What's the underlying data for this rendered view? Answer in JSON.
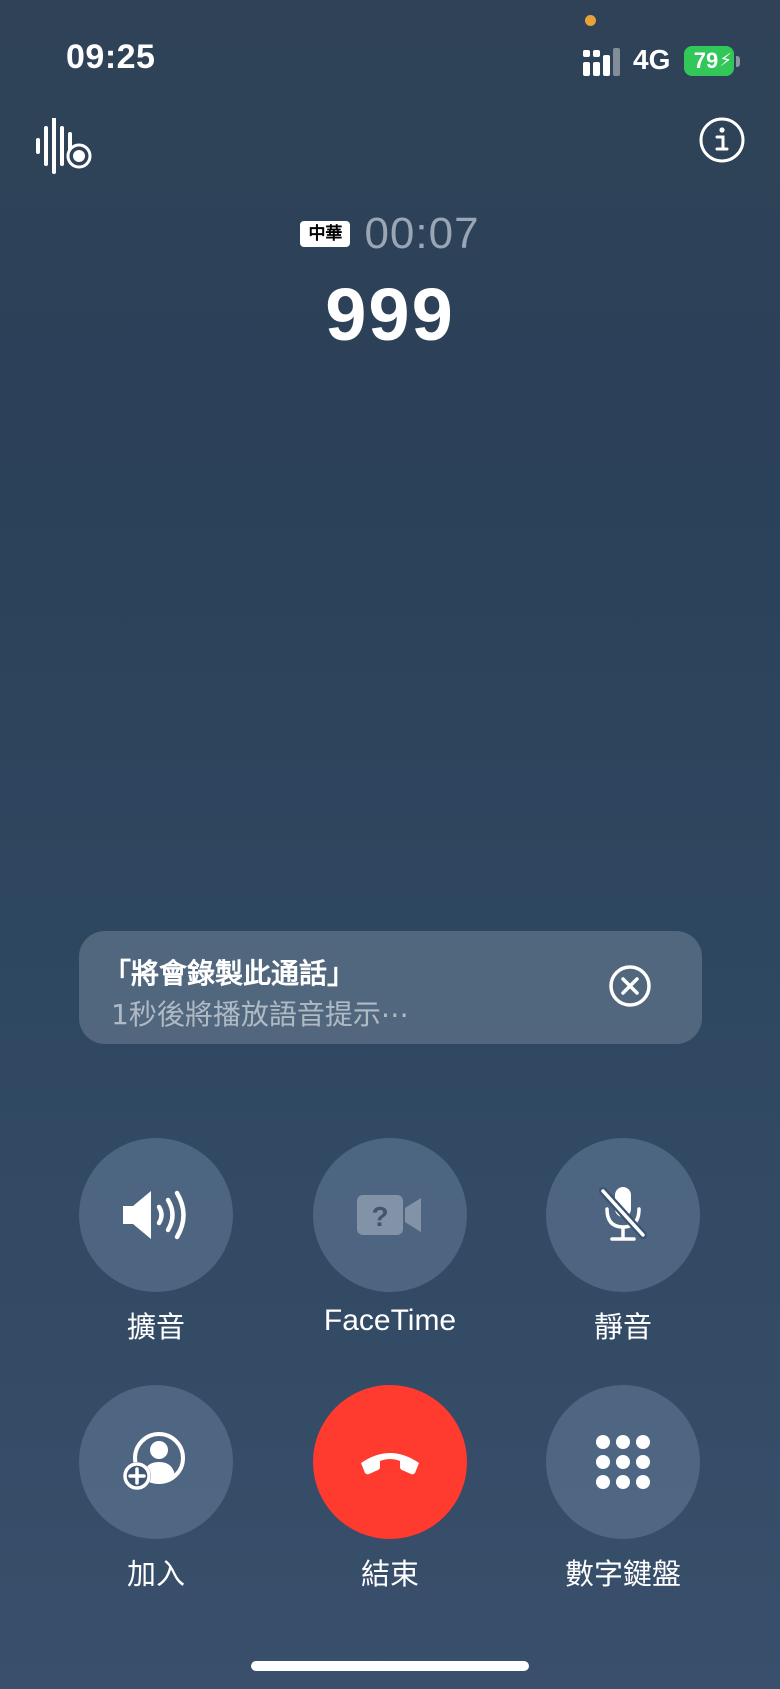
{
  "status_bar": {
    "time": "09:25",
    "network": "4G",
    "battery": "79",
    "signal_bars": 4,
    "privacy_dot_color": "#e9a237",
    "battery_color": "#32c759"
  },
  "top_icons": {
    "left": "voice-waveform-record-icon",
    "right": "info-icon"
  },
  "call": {
    "carrier": "中華",
    "duration": "00:07",
    "number": "999"
  },
  "notice": {
    "title": "「將會錄製此通話」",
    "subtitle": "1秒後將播放語音提示⋯",
    "close_icon": "close-circle-icon"
  },
  "controls": [
    {
      "label": "擴音",
      "icon": "speaker-icon"
    },
    {
      "label": "FaceTime",
      "icon": "facetime-unavailable-icon"
    },
    {
      "label": "靜音",
      "icon": "mute-microphone-icon"
    },
    {
      "label": "加入",
      "icon": "add-call-icon"
    },
    {
      "label": "結束",
      "icon": "end-call-icon"
    },
    {
      "label": "數字鍵盤",
      "icon": "keypad-icon"
    }
  ],
  "colors": {
    "end_call": "#ff3b30",
    "button_bg": "rgba(110,135,165,0.45)"
  }
}
